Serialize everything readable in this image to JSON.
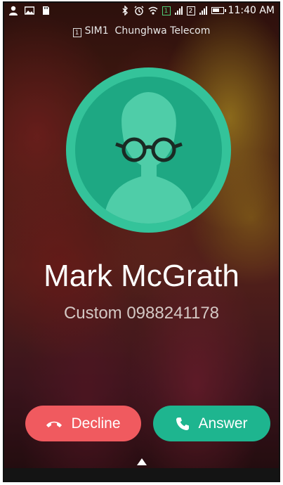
{
  "status_bar": {
    "time": "11:40 AM",
    "sim1_badge": "1",
    "sim2_badge": "2",
    "icons": [
      "person-icon",
      "image-icon",
      "sd-card-icon",
      "bluetooth-icon",
      "alarm-icon",
      "wifi-icon",
      "sim1-signal-icon",
      "sim2-signal-icon",
      "battery-icon"
    ]
  },
  "carrier": {
    "sim_badge": "1",
    "label": "SIM1",
    "name": "Chunghwa Telecom"
  },
  "caller": {
    "name": "Mark McGrath",
    "subtitle": "Custom 0988241178"
  },
  "actions": {
    "decline_label": "Decline",
    "answer_label": "Answer"
  },
  "colors": {
    "avatar_ring": "#34c39a",
    "avatar_fill": "#1ea883",
    "decline": "#f05a5f",
    "answer": "#1eb58f",
    "sim_active": "#4fd07a"
  }
}
